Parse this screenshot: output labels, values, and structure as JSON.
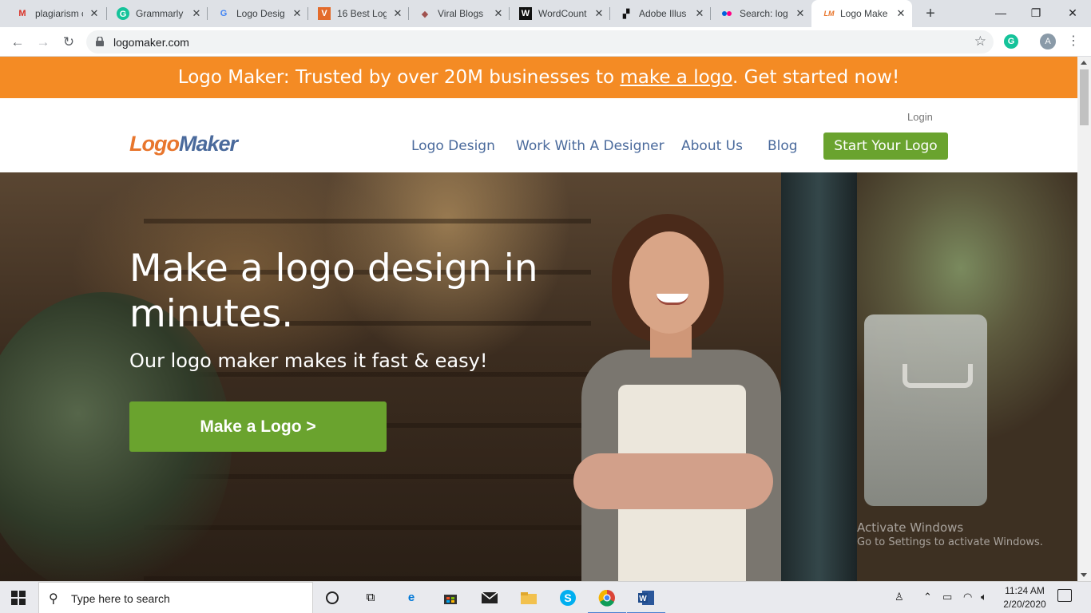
{
  "browser": {
    "tabs": [
      {
        "title": "plagiarism c",
        "icon": "gmail-icon",
        "color": "#d93025",
        "glyph": "M"
      },
      {
        "title": "Grammarly",
        "icon": "grammarly-icon",
        "color": "#15c39a",
        "glyph": "G"
      },
      {
        "title": "Logo Desig",
        "icon": "google-icon",
        "color": "#4285f4",
        "glyph": "G"
      },
      {
        "title": "16 Best Log",
        "icon": "vectr-icon",
        "color": "#e36b2b",
        "glyph": "V"
      },
      {
        "title": "Viral Blogs",
        "icon": "viral-blogs-icon",
        "color": "#a0524f",
        "glyph": "◆"
      },
      {
        "title": "WordCount",
        "icon": "wordcount-icon",
        "color": "#111111",
        "glyph": "W"
      },
      {
        "title": "Adobe Illus",
        "icon": "adobe-icon",
        "color": "#111111",
        "glyph": "▞"
      },
      {
        "title": "Search: log",
        "icon": "flickr-icon",
        "color": "#e0007a",
        "glyph": "••"
      },
      {
        "title": "Logo Make",
        "icon": "logomaker-icon",
        "color": "#e8762d",
        "glyph": "LM"
      }
    ],
    "url": "logomaker.com",
    "profile_initial": "A",
    "extension_glyph": "G"
  },
  "page": {
    "banner": {
      "prefix": "Logo Maker: Trusted by over 20M businesses to ",
      "link": "make a logo",
      "suffix": ". Get started now!"
    },
    "header": {
      "logo_part1": "Logo",
      "logo_part2": "Maker",
      "login": "Login",
      "nav": [
        "Logo Design",
        "Work With A Designer",
        "About Us",
        "Blog"
      ],
      "cta": "Start Your Logo"
    },
    "hero": {
      "title": "Make a logo design in minutes.",
      "subtitle": "Our logo maker makes it fast & easy!",
      "button": "Make a Logo >"
    },
    "watermark": {
      "line1": "Activate Windows",
      "line2": "Go to Settings to activate Windows."
    }
  },
  "taskbar": {
    "search_placeholder": "Type here to search",
    "time": "11:24 AM",
    "date": "2/20/2020"
  },
  "colors": {
    "banner": "#f48b24",
    "accent_green": "#6aa32e",
    "nav_blue": "#4a6a9c",
    "logo_orange": "#e8762d"
  }
}
